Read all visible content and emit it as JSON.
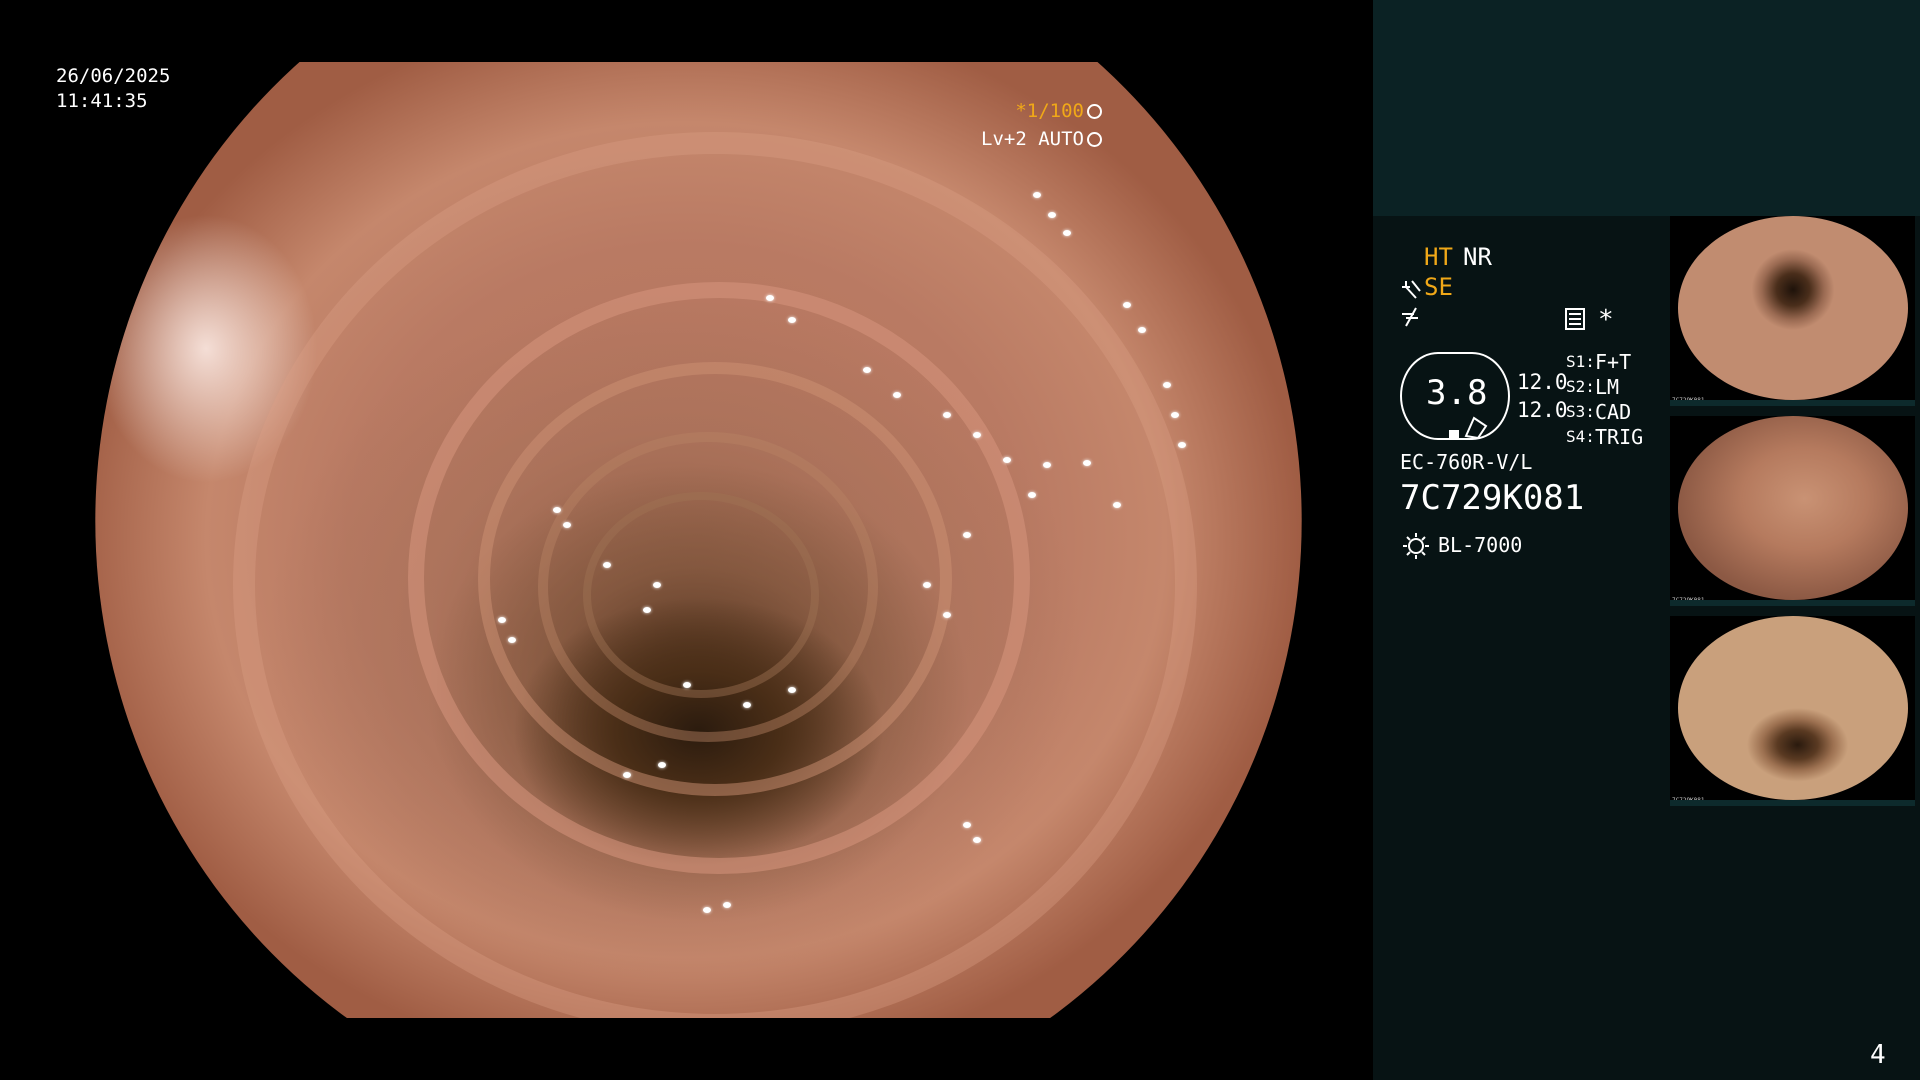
{
  "overlay": {
    "date": "26/06/2025",
    "time": "11:41:35",
    "shutter": "*1/100",
    "level": "Lv+2 AUTO"
  },
  "settings": {
    "ht": "HT",
    "nr": "NR",
    "se": "SE",
    "ct_value": "3.8",
    "val1": "12.0",
    "val2": "12.0",
    "s1_key": "S1:",
    "s1_val": "F+T",
    "s2_key": "S2:",
    "s2_val": "LM",
    "s3_key": "S3:",
    "s3_val": "CAD",
    "s4_key": "S4:",
    "s4_val": "TRIG",
    "asterisk": "*"
  },
  "scope": {
    "model": "EC-760R-V/L",
    "serial": "7C729K081",
    "light_source": "BL-7000"
  },
  "thumbnails": [
    {
      "label": "7C729K081"
    },
    {
      "label": "7C729K081"
    },
    {
      "label": "7C729K081"
    }
  ],
  "page_number": "4"
}
